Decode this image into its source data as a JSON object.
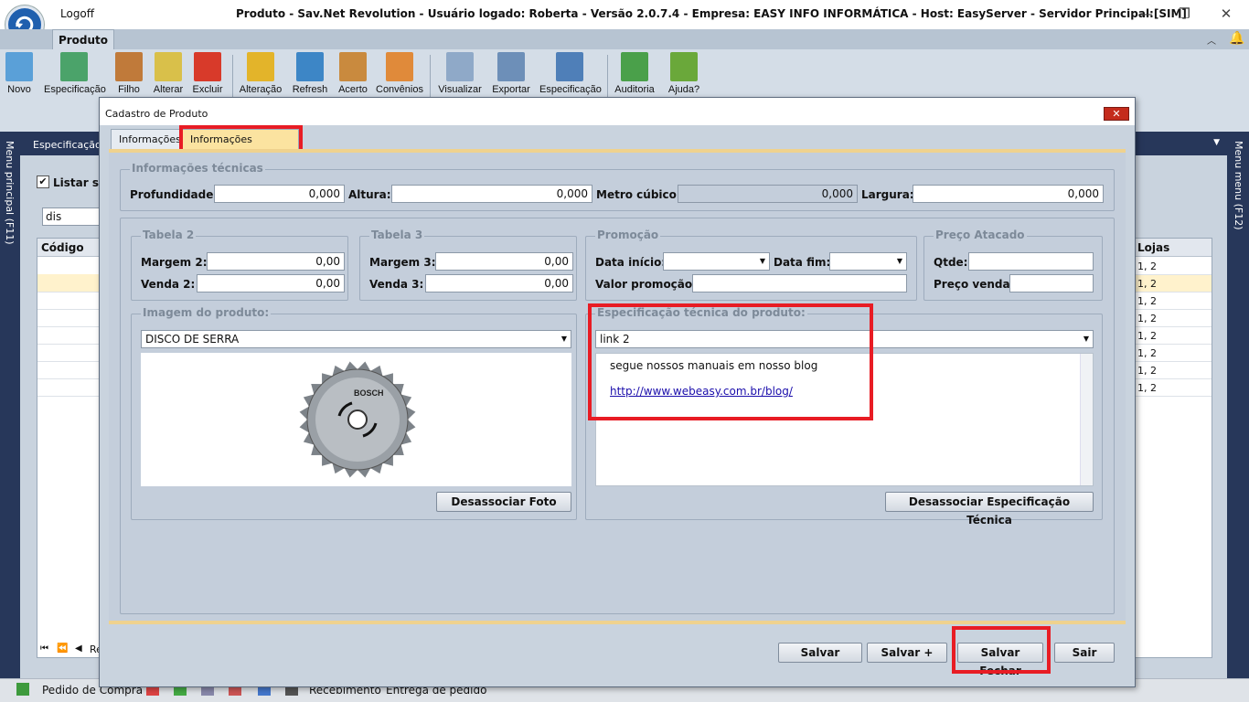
{
  "app": {
    "logoff": "Logoff",
    "window_title": "Produto - Sav.Net Revolution - Usuário logado: Roberta - Versão 2.0.7.4 - Empresa: EASY INFO INFORMÁTICA - Host: EasyServer - Servidor Principal:[SIM]",
    "ribbon_tab": "Produto",
    "ribbon_buttons": [
      {
        "label": "Novo",
        "icon": "new-icon",
        "color": "#5aa0d8"
      },
      {
        "label": "Especificação",
        "icon": "spec-icon",
        "color": "#4ba36a"
      },
      {
        "label": "Filho",
        "icon": "box-icon",
        "color": "#c07a3a"
      },
      {
        "label": "Alterar",
        "icon": "pencil-icon",
        "color": "#d9c04a"
      },
      {
        "label": "Excluir",
        "icon": "x-icon",
        "color": "#d83a2a"
      },
      {
        "label": "Alteração",
        "icon": "lock-icon",
        "color": "#e3b42a"
      },
      {
        "label": "Refresh",
        "icon": "refresh-icon",
        "color": "#3d86c6"
      },
      {
        "label": "Acerto",
        "icon": "boxes-icon",
        "color": "#c98a3e"
      },
      {
        "label": "Convênios",
        "icon": "doc-person-icon",
        "color": "#e08a3a"
      },
      {
        "label": "Visualizar",
        "icon": "magnifier-icon",
        "color": "#8fa9c8"
      },
      {
        "label": "Exportar",
        "icon": "export-icon",
        "color": "#6d8fb8"
      },
      {
        "label": "Especificação",
        "icon": "table-icon",
        "color": "#4f7fb8"
      },
      {
        "label": "Auditoria",
        "icon": "audit-icon",
        "color": "#4aa04a"
      },
      {
        "label": "Ajuda?",
        "icon": "book-icon",
        "color": "#6aa83a"
      }
    ],
    "left_menu": "Menu principal (F11)",
    "right_menu": "Menu menu (F12)",
    "bg_header": "Especificação t",
    "bg_checkbox": "Listar so",
    "bg_search": "dis",
    "bg_col_codigo": "Código",
    "bg_col_lojas": "Lojas",
    "bg_lojas_rows": [
      "1, 2",
      "1, 2",
      "1, 2",
      "1, 2",
      "1, 2",
      "1, 2",
      "1, 2",
      "1, 2"
    ],
    "bg_pager": "Re",
    "status_items": [
      "Pedido de Compra",
      "Recebimento",
      "Entrega de pedido"
    ]
  },
  "dialog": {
    "title": "Cadastro de Produto",
    "close": "✕",
    "tabs": [
      "Informações",
      "Informações adicionais"
    ],
    "info_tecnicas": {
      "legend": "Informações técnicas",
      "profundidade_label": "Profundidade:",
      "profundidade": "0,000",
      "altura_label": "Altura:",
      "altura": "0,000",
      "metro_label": "Metro cúbico:",
      "metro": "0,000",
      "largura_label": "Largura:",
      "largura": "0,000"
    },
    "tabela2": {
      "legend": "Tabela 2",
      "margem_label": "Margem 2:",
      "margem": "0,00",
      "venda_label": "Venda 2:",
      "venda": "0,00"
    },
    "tabela3": {
      "legend": "Tabela 3",
      "margem_label": "Margem 3:",
      "margem": "0,00",
      "venda_label": "Venda 3:",
      "venda": "0,00"
    },
    "promocao": {
      "legend": "Promoção",
      "inicio_label": "Data início:",
      "inicio": "",
      "fim_label": "Data fim:",
      "fim": "",
      "valor_label": "Valor promoção:",
      "valor": ""
    },
    "atacado": {
      "legend": "Preço Atacado",
      "qtde_label": "Qtde:",
      "qtde": "",
      "preco_label": "Preço venda:",
      "preco": ""
    },
    "imagem": {
      "legend": "Imagem do produto:",
      "selected": "DISCO DE SERRA",
      "image_icon": "saw-blade-icon",
      "brand": "BOSCH",
      "unbind": "Desassociar Foto"
    },
    "especificacao": {
      "legend": "Especificação técnica do produto:",
      "selected": "link 2",
      "text": "segue nossos manuais em nosso blog",
      "link": "http://www.webeasy.com.br/blog/",
      "unbind": "Desassociar Especificação Técnica"
    },
    "buttons": {
      "salvar": "Salvar",
      "salvar_plus": "Salvar +",
      "salvar_fechar": "Salvar Fechar",
      "sair": "Sair"
    }
  }
}
